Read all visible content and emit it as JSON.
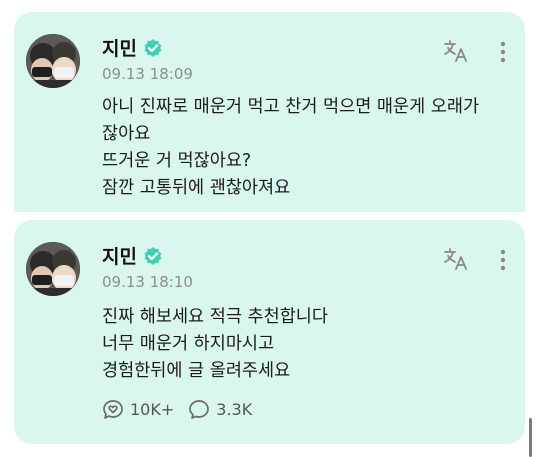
{
  "posts": [
    {
      "author": "지민",
      "time": "09.13 18:09",
      "lines": [
        "아니 진짜로 매운거 먹고 찬거 먹으면 매운게 오래가",
        "잖아요",
        "뜨거운 거 먹잖아요?",
        "잠깐 고통뒤에 괜찮아져요"
      ]
    },
    {
      "author": "지민",
      "time": "09.13 18:10",
      "lines": [
        "진짜 해보세요 적극 추천합니다",
        "너무 매운거 하지마시고",
        "경험한뒤에 글 올려주세요"
      ],
      "likes": "10K+",
      "comments": "3.3K"
    }
  ],
  "icons": {
    "verified": "verified-badge-icon",
    "translate": "translate-icon",
    "more": "more-vertical-icon",
    "like": "bubble-heart-icon",
    "comment": "comment-bubble-icon"
  },
  "colors": {
    "card_bg": "#d9f7ef",
    "verified": "#3ed0b0",
    "icon": "#8a8a8a"
  }
}
